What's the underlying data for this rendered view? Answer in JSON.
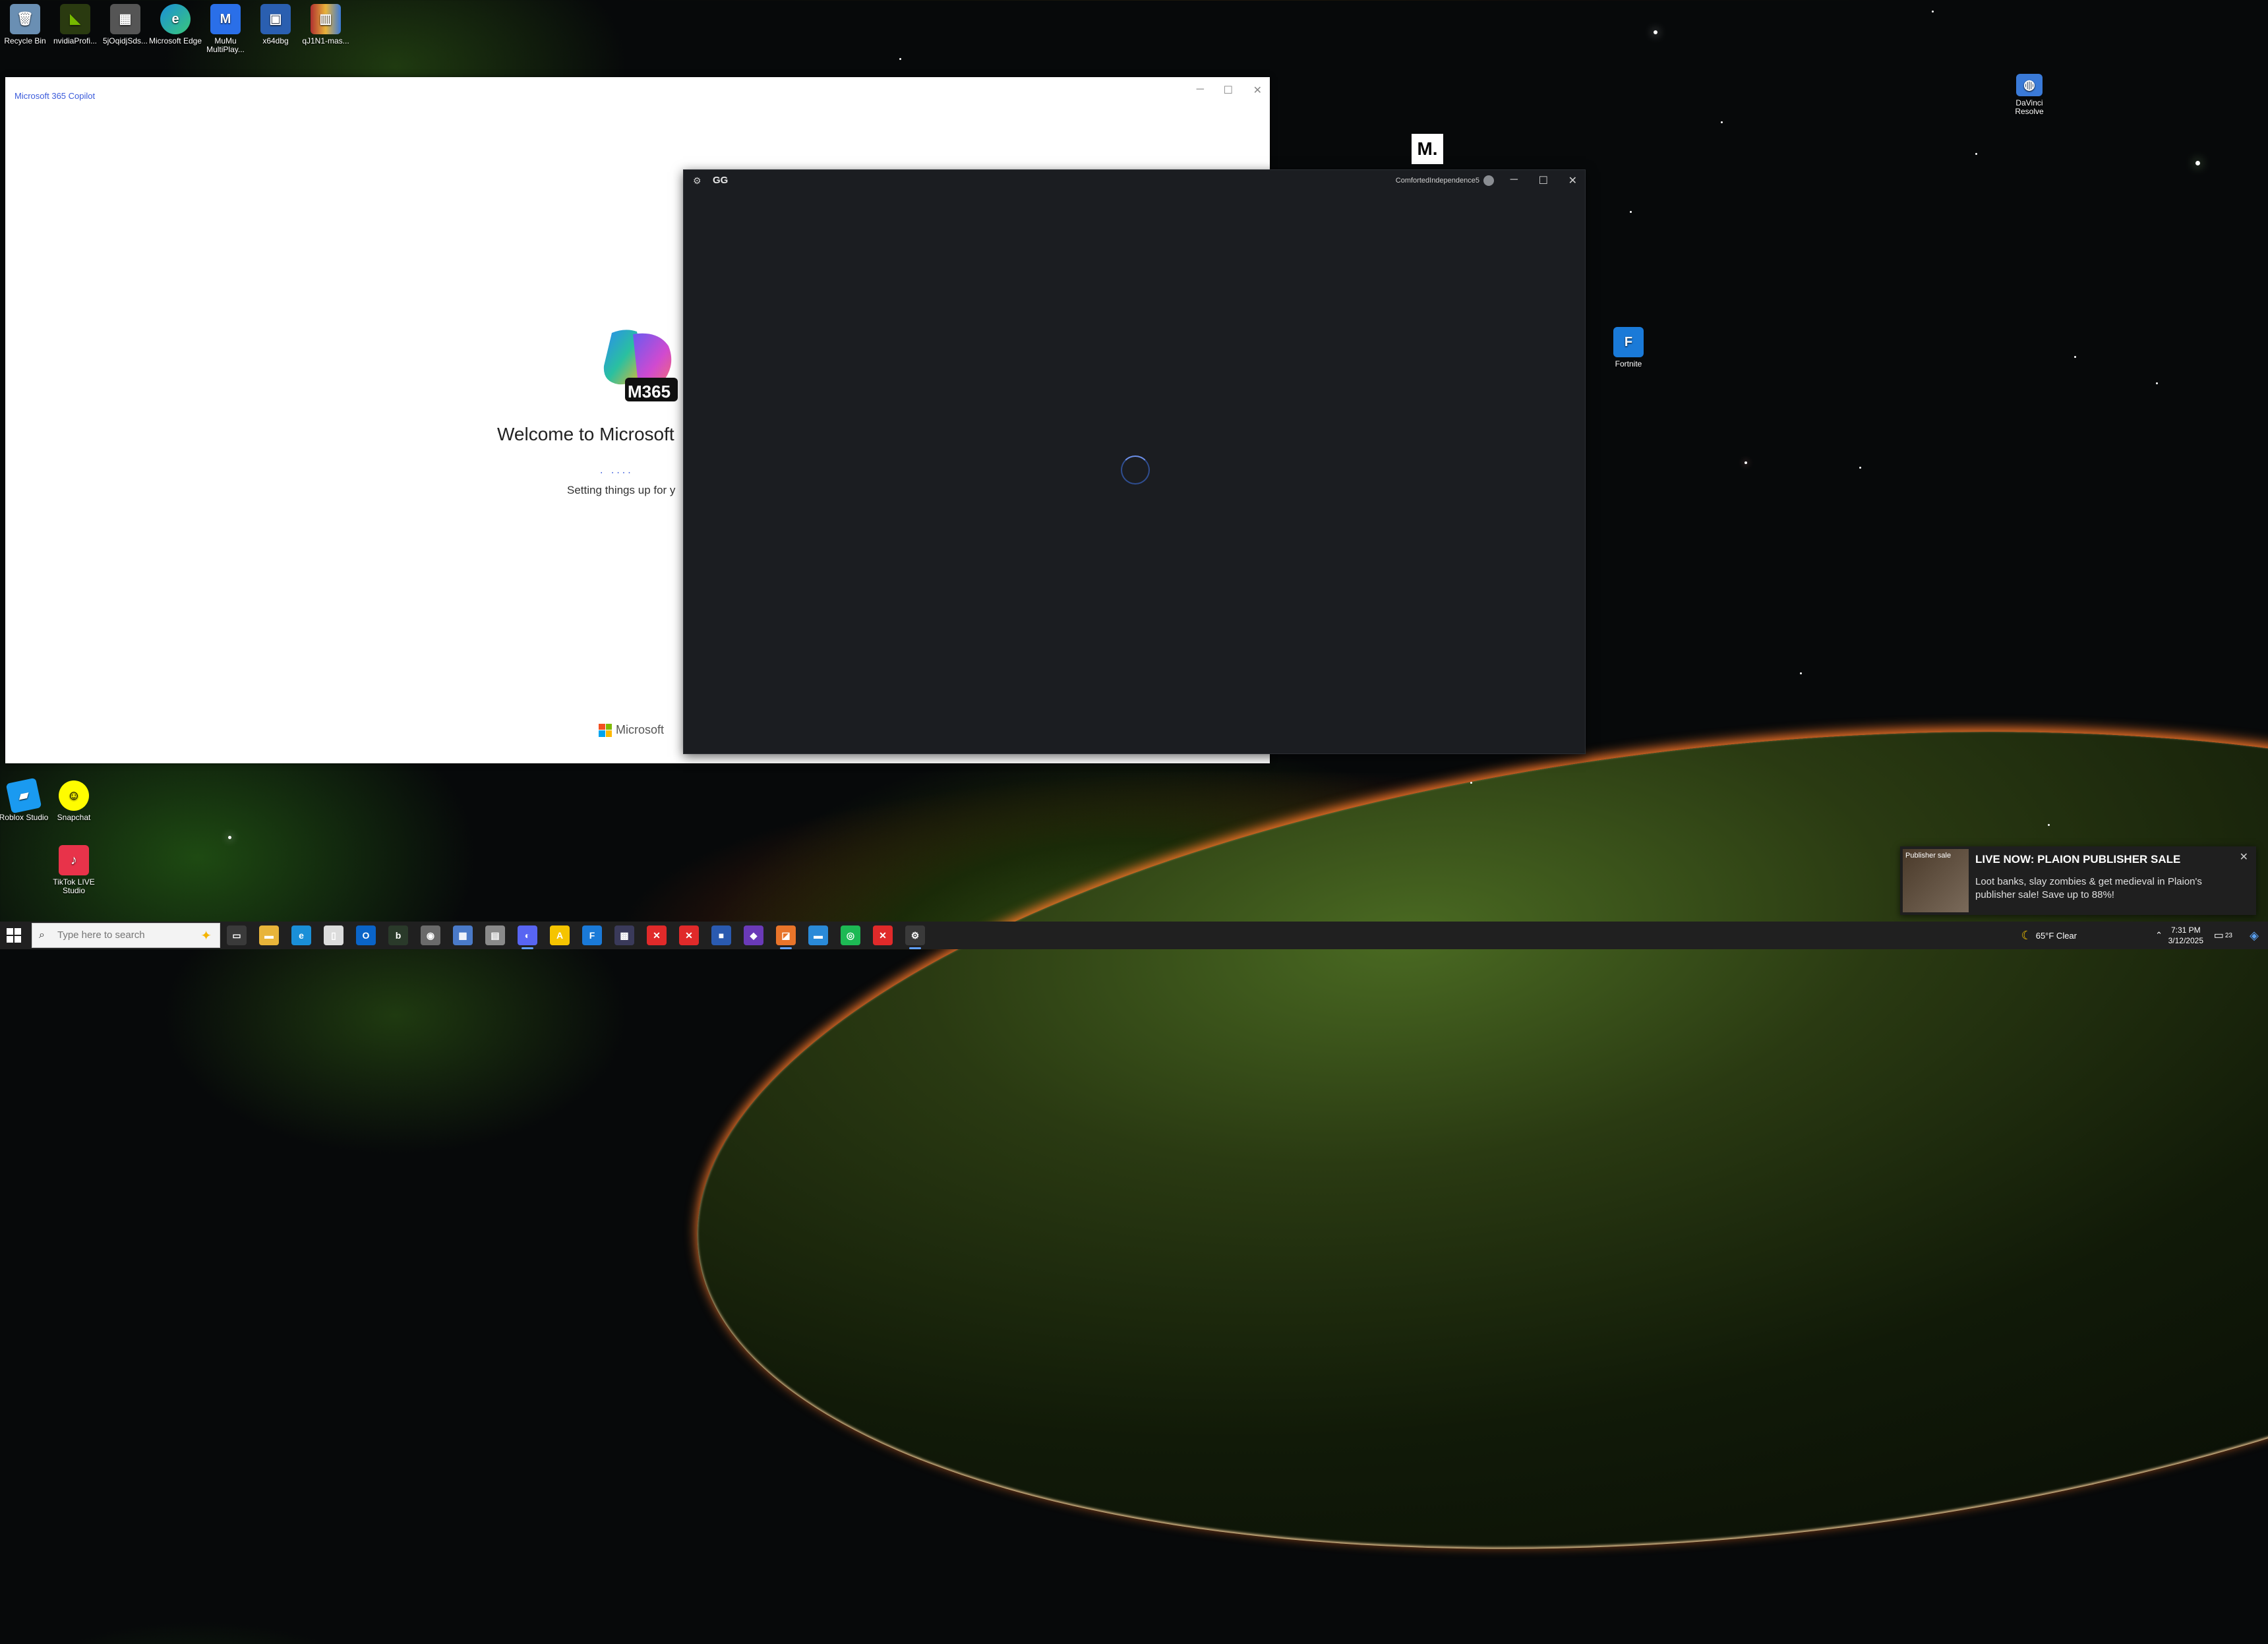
{
  "desktop": {
    "icons_top": [
      {
        "label": "Recycle Bin",
        "icon": "recycle-bin-icon",
        "color": "#6a8fb3"
      },
      {
        "label": "nvidiaProfi...",
        "icon": "nvidia-icon",
        "color": "#76b900"
      },
      {
        "label": "5jOqidjSds...",
        "icon": "image-file-icon",
        "color": "#555555"
      },
      {
        "label": "Microsoft Edge",
        "icon": "edge-icon",
        "color": "#1a8fd8"
      },
      {
        "label": "MuMu MultiPlay...",
        "icon": "mumu-icon",
        "color": "#2a6fe8"
      },
      {
        "label": "x64dbg",
        "icon": "x64dbg-icon",
        "color": "#2a5fb0"
      },
      {
        "label": "qJ1N1-mas...",
        "icon": "archive-icon",
        "color": "#b03030"
      }
    ],
    "icons_right": [
      {
        "label": "DaVinci Resolve",
        "icon": "davinci-resolve-icon",
        "color": "#3a7ad8"
      },
      {
        "label": "Fortnite",
        "icon": "fortnite-icon",
        "color": "#1a7ad8",
        "glyph": "F"
      }
    ],
    "icons_bottom": [
      {
        "label": "Roblox Studio",
        "icon": "roblox-studio-icon",
        "color": "#1a9af0"
      },
      {
        "label": "Snapchat",
        "icon": "snapchat-icon",
        "color": "#fffc00"
      },
      {
        "label": "TikTok LIVE Studio",
        "icon": "tiktok-live-icon",
        "color": "#e8334a"
      }
    ],
    "medium_glyph": "M."
  },
  "copilot_window": {
    "title": "Microsoft 365 Copilot",
    "logo_text": "M365",
    "welcome": "Welcome to Microsoft",
    "progress_dots": ". ....",
    "setup_text": "Setting things up for y",
    "footer": "Microsoft"
  },
  "gg_window": {
    "title": "GG",
    "username": "ComfortedIndependence5"
  },
  "notification": {
    "thumb_text": "Publisher sale",
    "title": "LIVE NOW: PLAION PUBLISHER SALE",
    "body": "Loot banks, slay zombies & get medieval in Plaion's publisher sale! Save up to 88%!"
  },
  "taskbar": {
    "search_placeholder": "Type here to search",
    "apps": [
      {
        "name": "task-view-icon",
        "color": "#3a3a3a",
        "glyph": "▭"
      },
      {
        "name": "file-explorer-icon",
        "color": "#e8b43a",
        "glyph": "▬"
      },
      {
        "name": "edge-icon",
        "color": "#1a8fd8",
        "glyph": "e"
      },
      {
        "name": "notepad-icon",
        "color": "#dcdcdc",
        "glyph": "▯"
      },
      {
        "name": "outlook-icon",
        "color": "#0a64c8",
        "glyph": "O"
      },
      {
        "name": "app-green-icon",
        "color": "#2a3a2a",
        "glyph": "b"
      },
      {
        "name": "chrome-app-icon",
        "color": "#6a6a6a",
        "glyph": "◉"
      },
      {
        "name": "photos-icon",
        "color": "#4a7ac8",
        "glyph": "▦"
      },
      {
        "name": "notes-icon",
        "color": "#8a8a8a",
        "glyph": "▤"
      },
      {
        "name": "discord-icon",
        "color": "#5865f2",
        "glyph": "◐"
      },
      {
        "name": "norton-icon",
        "color": "#f5c400",
        "glyph": "A"
      },
      {
        "name": "fortnite-icon",
        "color": "#1a7ad8",
        "glyph": "F"
      },
      {
        "name": "app-grid-icon",
        "color": "#3a3a5a",
        "glyph": "▩"
      },
      {
        "name": "close-app-icon",
        "color": "#e02a2a",
        "glyph": "✕"
      },
      {
        "name": "close-app-2-icon",
        "color": "#e02a2a",
        "glyph": "✕"
      },
      {
        "name": "app-blue-icon",
        "color": "#2a5ab0",
        "glyph": "■"
      },
      {
        "name": "visual-studio-icon",
        "color": "#6a3ab8",
        "glyph": "◆"
      },
      {
        "name": "app-orange-icon",
        "color": "#e8742a",
        "glyph": "◪"
      },
      {
        "name": "explorer-folder-icon",
        "color": "#2a8ad8",
        "glyph": "▬"
      },
      {
        "name": "spotify-icon",
        "color": "#1db954",
        "glyph": "◎"
      },
      {
        "name": "error-app-icon",
        "color": "#e02a2a",
        "glyph": "✕"
      },
      {
        "name": "gg-app-icon",
        "color": "#3a3a3a",
        "glyph": "⚙"
      }
    ],
    "weather": "65°F  Clear",
    "time": "7:31 PM",
    "date": "3/12/2025",
    "notif_count": "23"
  }
}
